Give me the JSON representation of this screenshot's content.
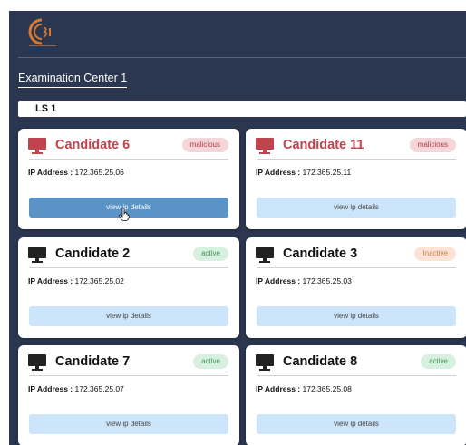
{
  "center_title": "Examination Center 1",
  "section_label": "LS 1",
  "ip_label": "IP Address :",
  "cards": [
    {
      "name": "Candidate 6",
      "status": "malicious",
      "ip": "172.365.25.06",
      "button": "view ip details"
    },
    {
      "name": "Candidate 11",
      "status": "malicious",
      "ip": "172.365.25.11",
      "button": "view ip details"
    },
    {
      "name": "Candidate 2",
      "status": "active",
      "ip": "172.365.25.02",
      "button": "view ip details"
    },
    {
      "name": "Candidate 3",
      "status": "Inactive",
      "ip": "172.365.25.03",
      "button": "view ip details"
    },
    {
      "name": "Candidate 7",
      "status": "active",
      "ip": "172.365.25.07",
      "button": "view ip details"
    },
    {
      "name": "Candidate 8",
      "status": "active",
      "ip": "172.365.25.08",
      "button": "view ip details"
    }
  ],
  "colors": {
    "background": "#2b3650",
    "malicious_text": "#c0434d",
    "active_badge": "#3d9456",
    "inactive_badge": "#d07b4f",
    "button_primary": "#5a93c6",
    "button_light": "#cde5fa"
  },
  "icons": {
    "logo": "c3i-logo",
    "monitor": "monitor-icon",
    "cursor": "hand-pointer-icon"
  }
}
